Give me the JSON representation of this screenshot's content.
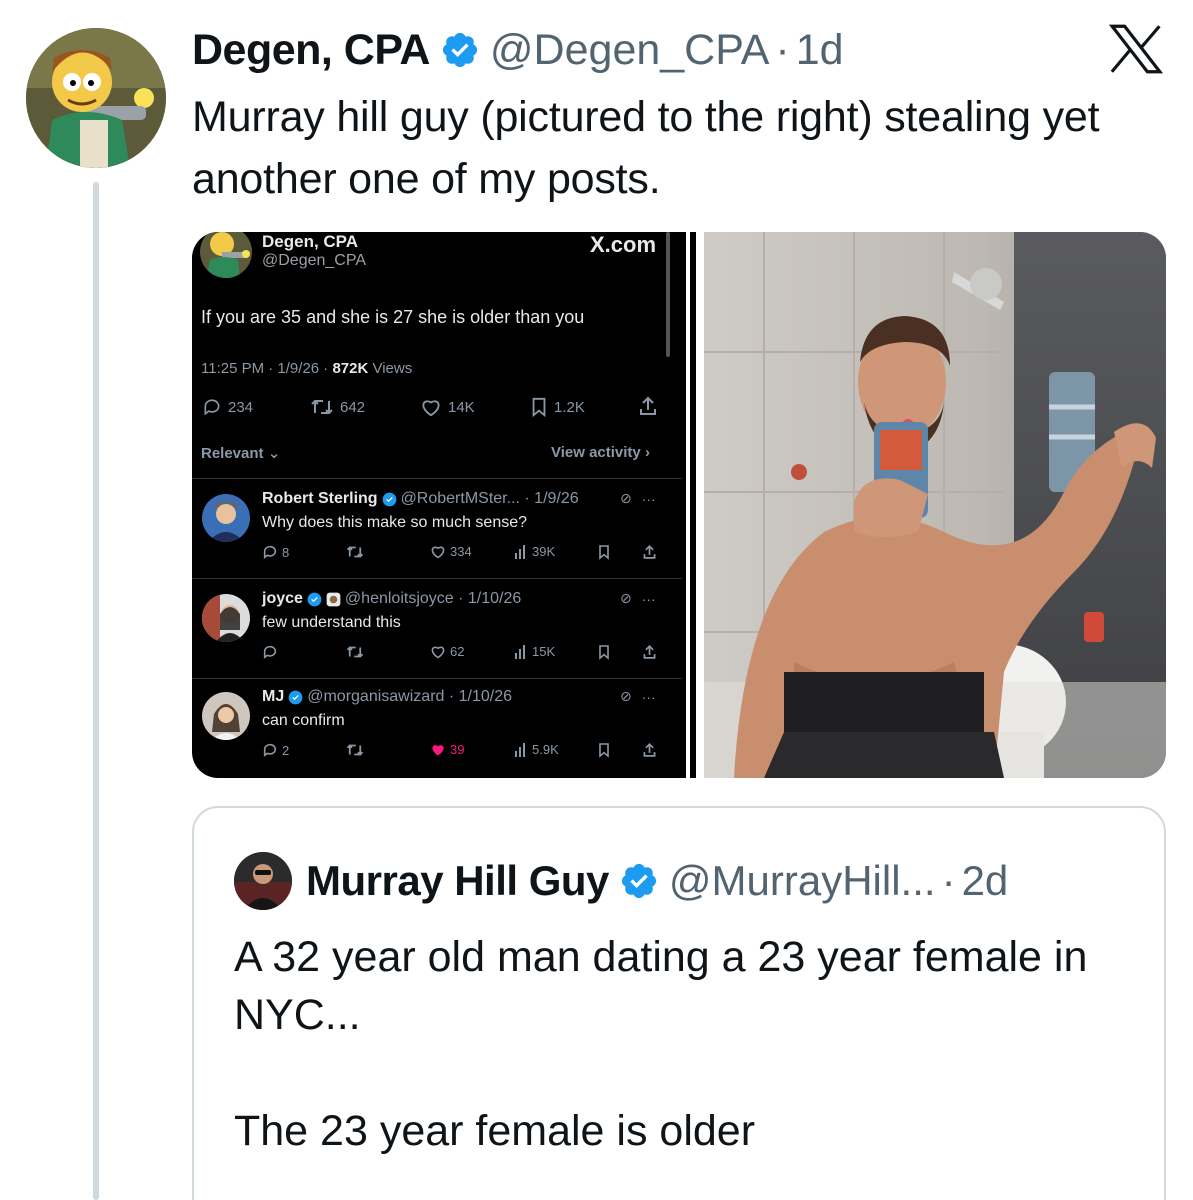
{
  "tweet": {
    "author_name": "Degen, CPA",
    "handle": "@Degen_CPA",
    "separator": "·",
    "time": "1d",
    "text": "Murray hill guy (pictured to the right) stealing yet another one of my posts.",
    "verified_color": "#1d9bf0",
    "avatar_icon": "cartoon-avatar"
  },
  "x_logo_icon": "x-logo-icon",
  "screenshot": {
    "author_name": "Degen, CPA",
    "handle": "@Degen_CPA",
    "watermark": "X.com",
    "text": "If you are 35 and she is 27 she is older than you",
    "time": "11:25 PM · 1/9/26 · ",
    "views_count": "872K",
    "views_label": " Views",
    "stats": {
      "replies": "234",
      "reposts": "642",
      "likes": "14K",
      "bookmarks": "1.2K"
    },
    "relevant_label": "Relevant",
    "activity_label": "View activity",
    "replies": [
      {
        "name": "Robert Sterling",
        "handle": "@RobertMSter... · 1/9/26",
        "text": "Why does this make so much sense?",
        "replies": "8",
        "reposts": "",
        "likes": "334",
        "views": "39K"
      },
      {
        "name": "joyce",
        "handle": "@henloitsjoyce · 1/10/26",
        "text": "few understand this",
        "replies": "",
        "reposts": "",
        "likes": "62",
        "views": "15K"
      },
      {
        "name": "MJ",
        "handle": "@morganisawizard · 1/10/26",
        "text": "can confirm",
        "replies": "2",
        "reposts": "",
        "likes": "39",
        "views": "5.9K"
      }
    ]
  },
  "quote": {
    "author_name": "Murray Hill Guy",
    "handle": "@MurrayHill...",
    "separator": "·",
    "time": "2d",
    "text": "A 32 year old man dating a 23 year female in NYC...\n\nThe 23 year female is older"
  }
}
